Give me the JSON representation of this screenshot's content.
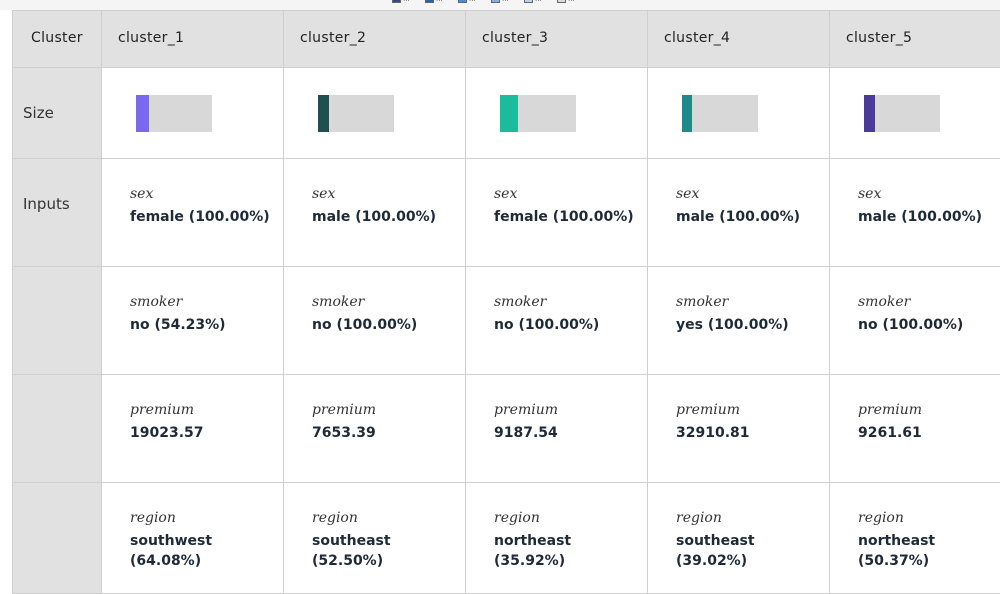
{
  "legend": [
    {
      "label": "...",
      "color": "#3a4a7a"
    },
    {
      "label": "...",
      "color": "#2e5fa8"
    },
    {
      "label": "...",
      "color": "#4a8cd8"
    },
    {
      "label": "...",
      "color": "#7fb2e8"
    },
    {
      "label": "...",
      "color": "#b8d4f0"
    },
    {
      "label": "...",
      "color": "#dcdcdc"
    }
  ],
  "table": {
    "corner_header": "Cluster",
    "clusters": [
      "cluster_1",
      "cluster_2",
      "cluster_3",
      "cluster_4",
      "cluster_5"
    ],
    "row_labels": {
      "size": "Size",
      "inputs": "Inputs"
    },
    "size": [
      {
        "color": "#7b68ee",
        "fraction": 0.17
      },
      {
        "color": "#1f4f4f",
        "fraction": 0.15
      },
      {
        "color": "#1abc9c",
        "fraction": 0.24
      },
      {
        "color": "#1f8a8a",
        "fraction": 0.13
      },
      {
        "color": "#4b3a9a",
        "fraction": 0.15
      }
    ],
    "features": [
      {
        "name": "sex",
        "values": [
          "female (100.00%)",
          "male (100.00%)",
          "female (100.00%)",
          "male (100.00%)",
          "male (100.00%)"
        ]
      },
      {
        "name": "smoker",
        "values": [
          "no (54.23%)",
          "no (100.00%)",
          "no (100.00%)",
          "yes (100.00%)",
          "no (100.00%)"
        ]
      },
      {
        "name": "premium",
        "values": [
          "19023.57",
          "7653.39",
          "9187.54",
          "32910.81",
          "9261.61"
        ]
      },
      {
        "name": "region",
        "values": [
          "southwest (64.08%)",
          "southeast (52.50%)",
          "northeast (35.92%)",
          "southeast (39.02%)",
          "northeast (50.37%)"
        ]
      }
    ]
  }
}
